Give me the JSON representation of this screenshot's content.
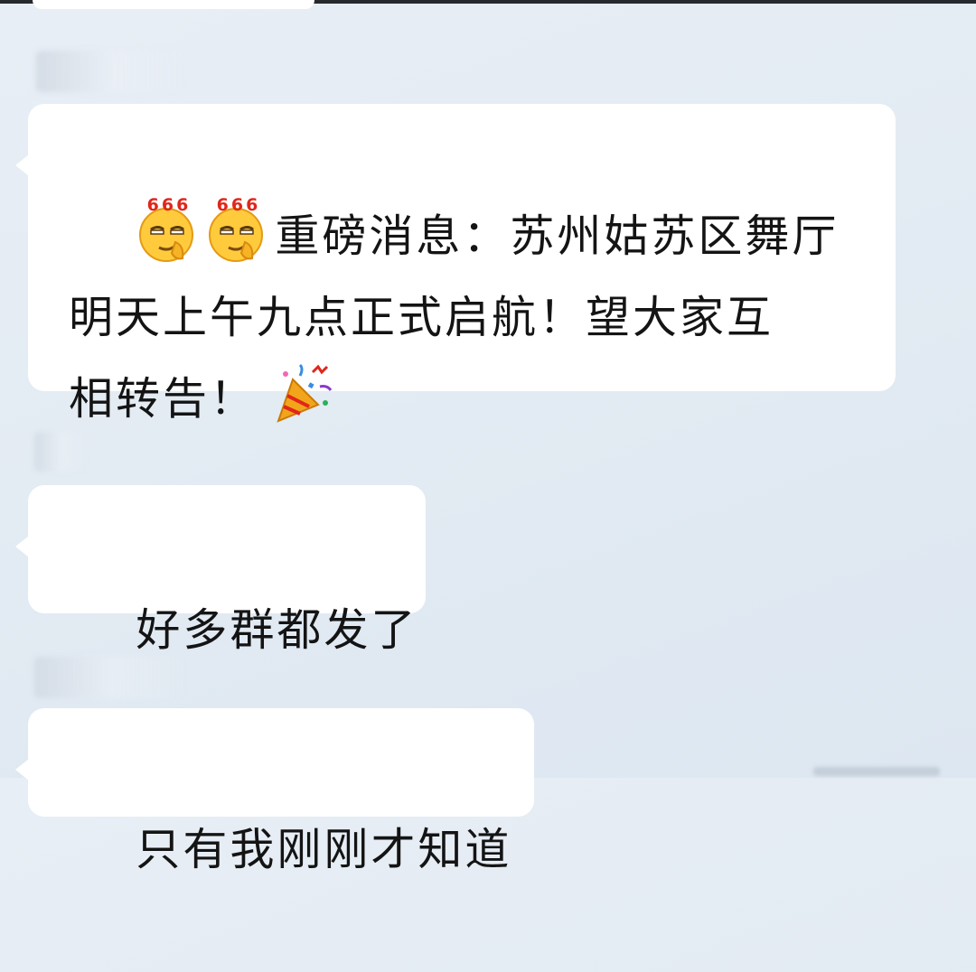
{
  "chat": {
    "messages": [
      {
        "emoji_prefix": [
          "smirk-666-emoji",
          "smirk-666-emoji"
        ],
        "emoji_badge_text": "666",
        "line1": "重磅消息：苏州姑苏区舞厅",
        "line2": "明天上午九点正式启航！望大家互",
        "line3": "相转告！",
        "emoji_suffix": "party-popper-emoji"
      },
      {
        "text": "好多群都发了"
      },
      {
        "text": "只有我刚刚才知道"
      }
    ]
  },
  "colors": {
    "background": "#e3ebf3",
    "bubble": "#ffffff",
    "text": "#141414",
    "top_bar": "#26292e"
  }
}
